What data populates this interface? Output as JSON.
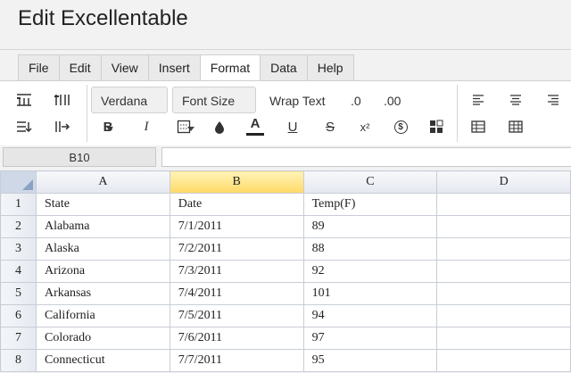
{
  "app": {
    "title": "Edit Excellentable"
  },
  "menu": {
    "tabs": [
      "File",
      "Edit",
      "View",
      "Insert",
      "Format",
      "Data",
      "Help"
    ],
    "active": "Format"
  },
  "toolbar": {
    "font_label": "Verdana",
    "font_size_label": "Font Size",
    "wrap_text_label": "Wrap Text",
    "decimal_less_label": ".0",
    "decimal_more_label": ".00",
    "bold_label": "B",
    "italic_label": "I",
    "font_color_label": "A",
    "underline_label": "U",
    "strike_label": "S",
    "superscript_label": "x²",
    "currency_label": "$",
    "font_color_bar": "#222222"
  },
  "formula_bar": {
    "cell_ref": "B10",
    "value": ""
  },
  "grid": {
    "columns": [
      "A",
      "B",
      "C",
      "D"
    ],
    "selected_column": "B",
    "rows": [
      {
        "num": "1",
        "cells": [
          "State",
          "Date",
          "Temp(F)",
          ""
        ]
      },
      {
        "num": "2",
        "cells": [
          "Alabama",
          "7/1/2011",
          "89",
          ""
        ]
      },
      {
        "num": "3",
        "cells": [
          "Alaska",
          "7/2/2011",
          "88",
          ""
        ]
      },
      {
        "num": "4",
        "cells": [
          "Arizona",
          "7/3/2011",
          "92",
          ""
        ]
      },
      {
        "num": "5",
        "cells": [
          "Arkansas",
          "7/4/2011",
          "101",
          ""
        ]
      },
      {
        "num": "6",
        "cells": [
          "California",
          "7/5/2011",
          "94",
          ""
        ]
      },
      {
        "num": "7",
        "cells": [
          "Colorado",
          "7/6/2011",
          "97",
          ""
        ]
      },
      {
        "num": "8",
        "cells": [
          "Connecticut",
          "7/7/2011",
          "95",
          ""
        ]
      }
    ]
  },
  "colors": {
    "selected_header": "#ffd966",
    "grid_line": "#c8cdd6",
    "accent": "#4a7fd4"
  }
}
